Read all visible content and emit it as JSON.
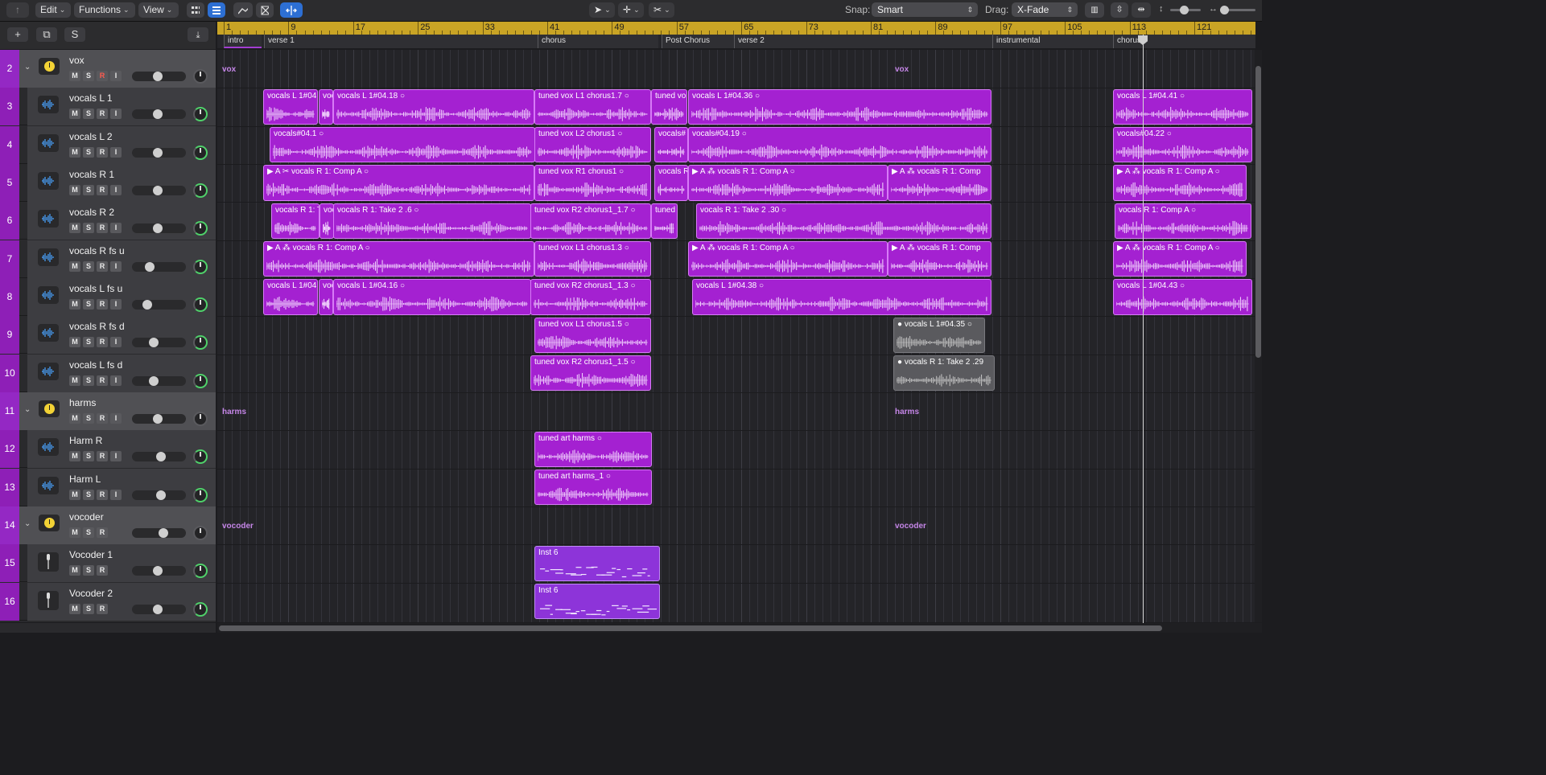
{
  "toolbar": {
    "edit_label": "Edit",
    "functions_label": "Functions",
    "view_label": "View",
    "snap_label": "Snap:",
    "snap_value": "Smart",
    "drag_label": "Drag:",
    "drag_value": "X-Fade"
  },
  "header_tools": {
    "add_label": "+",
    "duplicate_label": "⧉",
    "s_label": "S"
  },
  "ruler": {
    "bars": [
      "1",
      "9",
      "17",
      "25",
      "33",
      "41",
      "49",
      "57",
      "65",
      "73",
      "81",
      "89",
      "97",
      "105",
      "113",
      "121"
    ]
  },
  "markers": [
    {
      "label": "intro"
    },
    {
      "label": "verse 1"
    },
    {
      "label": "chorus"
    },
    {
      "label": "Post Chorus"
    },
    {
      "label": "verse 2"
    },
    {
      "label": "instrumental"
    },
    {
      "label": "chorus"
    }
  ],
  "tracks": [
    {
      "num": "2",
      "name": "vox",
      "type": "folder",
      "rec": true
    },
    {
      "num": "3",
      "name": "vocals L 1",
      "type": "audio"
    },
    {
      "num": "4",
      "name": "vocals L 2",
      "type": "audio"
    },
    {
      "num": "5",
      "name": "vocals R 1",
      "type": "audio"
    },
    {
      "num": "6",
      "name": "vocals R 2",
      "type": "audio"
    },
    {
      "num": "7",
      "name": "vocals R fs u",
      "type": "audio"
    },
    {
      "num": "8",
      "name": "vocals L fs u",
      "type": "audio"
    },
    {
      "num": "9",
      "name": "vocals R fs d",
      "type": "audio"
    },
    {
      "num": "10",
      "name": "vocals L fs d",
      "type": "audio"
    },
    {
      "num": "11",
      "name": "harms",
      "type": "folder"
    },
    {
      "num": "12",
      "name": "Harm R",
      "type": "audio"
    },
    {
      "num": "13",
      "name": "Harm L",
      "type": "audio"
    },
    {
      "num": "14",
      "name": "vocoder",
      "type": "folder-inst"
    },
    {
      "num": "15",
      "name": "Vocoder 1",
      "type": "inst"
    },
    {
      "num": "16",
      "name": "Vocoder 2",
      "type": "inst"
    }
  ],
  "folder_tags": [
    "vox",
    "vox",
    "harms",
    "harms",
    "vocoder",
    "vocoder"
  ],
  "regions": [
    {
      "row": 1,
      "name": "vocals L 1#04.",
      "kind": "audio"
    },
    {
      "row": 1,
      "name": "voc",
      "kind": "audio"
    },
    {
      "row": 1,
      "name": "vocals L 1#04.18  ○",
      "kind": "audio"
    },
    {
      "row": 1,
      "name": "tuned vox L1 chorus1.7  ○",
      "kind": "audio"
    },
    {
      "row": 1,
      "name": "tuned vo",
      "kind": "audio"
    },
    {
      "row": 1,
      "name": "vocals L 1#04.36  ○",
      "kind": "audio"
    },
    {
      "row": 1,
      "name": "vocals L 1#04.41  ○",
      "kind": "audio"
    },
    {
      "row": 2,
      "name": "vocals#04.1  ○",
      "kind": "audio"
    },
    {
      "row": 2,
      "name": "tuned vox L2 chorus1  ○",
      "kind": "audio"
    },
    {
      "row": 2,
      "name": "vocals#",
      "kind": "audio"
    },
    {
      "row": 2,
      "name": "vocals#04.19  ○",
      "kind": "audio"
    },
    {
      "row": 2,
      "name": "vocals#04.22  ○",
      "kind": "audio"
    },
    {
      "row": 3,
      "name": "▶ A ✂ vocals R 1: Comp A  ○",
      "kind": "audio"
    },
    {
      "row": 3,
      "name": "tuned vox R1 chorus1  ○",
      "kind": "audio"
    },
    {
      "row": 3,
      "name": "vocals R",
      "kind": "audio"
    },
    {
      "row": 3,
      "name": "▶ A ⁂ vocals R 1: Comp A  ○",
      "kind": "audio"
    },
    {
      "row": 3,
      "name": "▶ A ⁂ vocals R 1: Comp",
      "kind": "audio"
    },
    {
      "row": 3,
      "name": "▶ A ⁂ vocals R 1: Comp A  ○",
      "kind": "audio"
    },
    {
      "row": 4,
      "name": "vocals R 1: T",
      "kind": "audio"
    },
    {
      "row": 4,
      "name": "voc",
      "kind": "audio"
    },
    {
      "row": 4,
      "name": "vocals R 1: Take 2 .6  ○",
      "kind": "audio"
    },
    {
      "row": 4,
      "name": "tuned vox R2 chorus1_1.7  ○",
      "kind": "audio"
    },
    {
      "row": 4,
      "name": "tuned",
      "kind": "audio"
    },
    {
      "row": 4,
      "name": "vocals R 1: Take 2 .30  ○",
      "kind": "audio"
    },
    {
      "row": 4,
      "name": "vocals R 1: Comp A  ○",
      "kind": "audio"
    },
    {
      "row": 5,
      "name": "▶ A ⁂ vocals R 1: Comp A  ○",
      "kind": "audio"
    },
    {
      "row": 5,
      "name": "tuned vox L1 chorus1.3  ○",
      "kind": "audio"
    },
    {
      "row": 5,
      "name": "▶ A ⁂ vocals R 1: Comp A  ○",
      "kind": "audio"
    },
    {
      "row": 5,
      "name": "▶ A ⁂ vocals R 1: Comp",
      "kind": "audio"
    },
    {
      "row": 5,
      "name": "▶ A ⁂ vocals R 1: Comp A  ○",
      "kind": "audio"
    },
    {
      "row": 6,
      "name": "vocals L 1#04.",
      "kind": "audio"
    },
    {
      "row": 6,
      "name": "voc",
      "kind": "audio"
    },
    {
      "row": 6,
      "name": "vocals L 1#04.16  ○",
      "kind": "audio"
    },
    {
      "row": 6,
      "name": "tuned vox R2 chorus1_1.3  ○",
      "kind": "audio"
    },
    {
      "row": 6,
      "name": "vocals L 1#04.38  ○",
      "kind": "audio"
    },
    {
      "row": 6,
      "name": "vocals L 1#04.43  ○",
      "kind": "audio"
    },
    {
      "row": 7,
      "name": "tuned vox L1 chorus1.5  ○",
      "kind": "audio"
    },
    {
      "row": 7,
      "name": "● vocals L 1#04.35  ○",
      "kind": "gray"
    },
    {
      "row": 8,
      "name": "tuned vox R2 chorus1_1.5  ○",
      "kind": "audio"
    },
    {
      "row": 8,
      "name": "● vocals R 1: Take 2 .29",
      "kind": "gray"
    },
    {
      "row": 10,
      "name": "tuned art harms  ○",
      "kind": "audio"
    },
    {
      "row": 11,
      "name": "tuned art harms_1  ○",
      "kind": "audio"
    },
    {
      "row": 13,
      "name": "Inst 6",
      "kind": "inst"
    },
    {
      "row": 14,
      "name": "Inst 6",
      "kind": "inst"
    }
  ],
  "colors": {
    "region_purple": "#a421d1",
    "track_number": "#8e1fb7",
    "ruler": "#c9a425",
    "accent_blue": "#2d6fd3"
  }
}
